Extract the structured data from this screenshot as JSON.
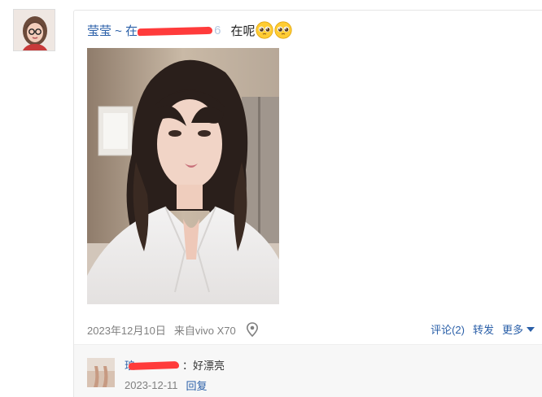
{
  "author": {
    "avatar_icon": "user-avatar"
  },
  "post": {
    "user_name": "莹莹 ~ 在",
    "user_name_tail": "6",
    "text": "在呢",
    "emojis": [
      "pleading-face-emoji",
      "pleading-face-emoji"
    ],
    "photo": "portrait-photo"
  },
  "meta": {
    "date": "2023年12月10日",
    "source": "来自vivo X70",
    "location_icon": "location-pin-icon",
    "comment_label": "评论(2)",
    "repost_label": "转发",
    "more_label": "更多"
  },
  "comments": [
    {
      "name": "琅",
      "text": "：好漂亮",
      "date": "2023-12-11",
      "reply_label": "回复"
    }
  ],
  "colors": {
    "link": "#2a5fa8",
    "meta_gray": "#808080",
    "redaction": "#ff3b3b",
    "comment_bg": "#f7f7f7"
  }
}
